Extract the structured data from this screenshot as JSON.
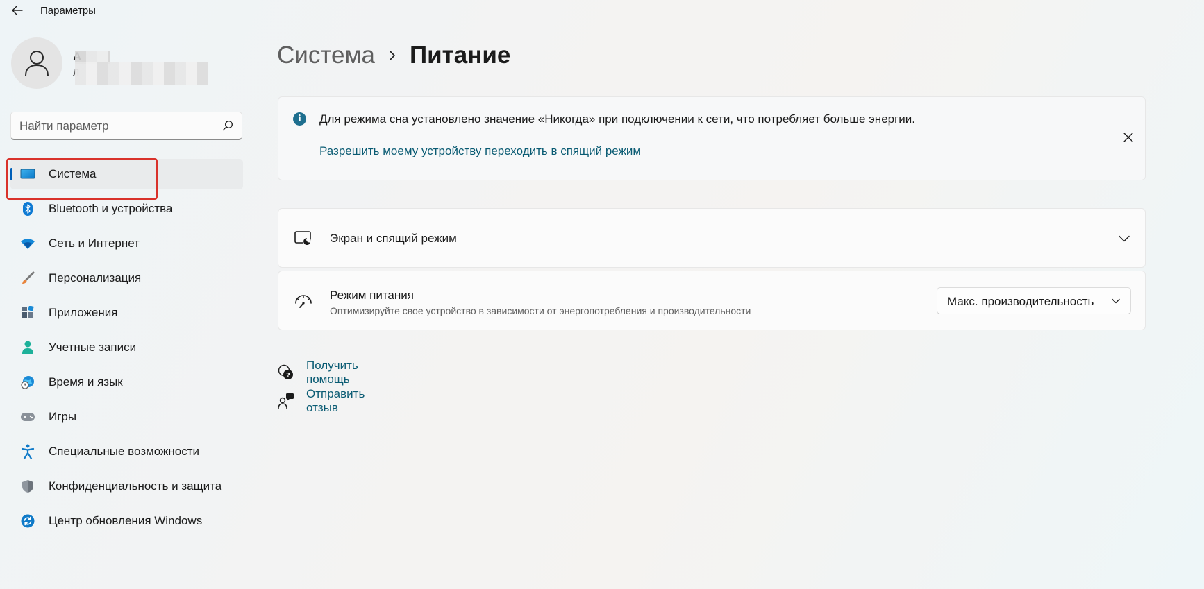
{
  "window": {
    "title": "Параметры"
  },
  "user": {
    "name": "А",
    "email": "Л"
  },
  "search": {
    "placeholder": "Найти параметр"
  },
  "sidebar": {
    "items": [
      {
        "label": "Система",
        "icon": "monitor-icon",
        "selected": true
      },
      {
        "label": "Bluetooth и устройства",
        "icon": "bluetooth-icon"
      },
      {
        "label": "Сеть и Интернет",
        "icon": "wifi-icon"
      },
      {
        "label": "Персонализация",
        "icon": "brush-icon"
      },
      {
        "label": "Приложения",
        "icon": "apps-icon"
      },
      {
        "label": "Учетные записи",
        "icon": "person-icon"
      },
      {
        "label": "Время и язык",
        "icon": "globe-clock-icon"
      },
      {
        "label": "Игры",
        "icon": "gamepad-icon"
      },
      {
        "label": "Специальные возможности",
        "icon": "accessibility-icon"
      },
      {
        "label": "Конфиденциальность и защита",
        "icon": "shield-icon"
      },
      {
        "label": "Центр обновления Windows",
        "icon": "update-icon"
      }
    ]
  },
  "breadcrumb": {
    "parent": "Система",
    "current": "Питание"
  },
  "info_bar": {
    "message": "Для режима сна установлено значение «Никогда» при подключении к сети, что потребляет больше энергии.",
    "link": "Разрешить моему устройству переходить в спящий режим"
  },
  "settings": {
    "screen_sleep": {
      "title": "Экран и спящий режим"
    },
    "power_mode": {
      "title": "Режим питания",
      "subtitle": "Оптимизируйте свое устройство в зависимости от энергопотребления и производительности",
      "selected": "Макс. производительность"
    }
  },
  "help": {
    "get_help": "Получить помощь",
    "feedback": "Отправить отзыв"
  },
  "colors": {
    "accent": "#005fb8",
    "link": "#0a5b73",
    "highlight_box": "#d9322b"
  }
}
